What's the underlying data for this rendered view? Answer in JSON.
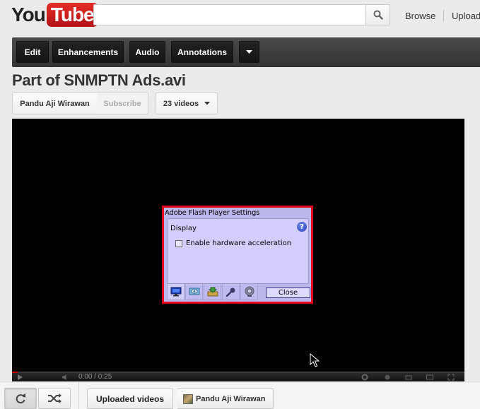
{
  "masthead": {
    "logo_you": "You",
    "logo_tube": "Tube",
    "search_placeholder": "",
    "search_icon": "search-icon",
    "links": {
      "browse": "Browse",
      "upload": "Upload"
    }
  },
  "edit_toolbar": {
    "edit": "Edit",
    "enhancements": "Enhancements",
    "audio": "Audio",
    "annotations": "Annotations",
    "more_icon": "caret-down-icon"
  },
  "video": {
    "title": "Part of SNMPTN Ads.avi",
    "channel_name": "Pandu Aji Wirawan",
    "subscribe_label": "Subscribe",
    "videos_count_label": "23 videos"
  },
  "flash_dialog": {
    "title": "Adobe Flash Player Settings",
    "section": "Display",
    "checkbox_label": "Enable hardware acceleration",
    "checkbox_checked": false,
    "close_label": "Close",
    "tabs": [
      "display-icon",
      "privacy-icon",
      "storage-icon",
      "microphone-icon",
      "camera-icon"
    ],
    "accent_color": "#e3071c"
  },
  "player": {
    "progress_fraction": 0.0125,
    "time_text": "0:00 / 0:25"
  },
  "bottom_bar": {
    "tab_uploaded": "Uploaded videos",
    "tab_channel": "Pandu Aji Wirawan"
  },
  "colors": {
    "brand_red": "#cc181e",
    "toolbar_dark": "#333333",
    "page_bg": "#ebebeb"
  }
}
